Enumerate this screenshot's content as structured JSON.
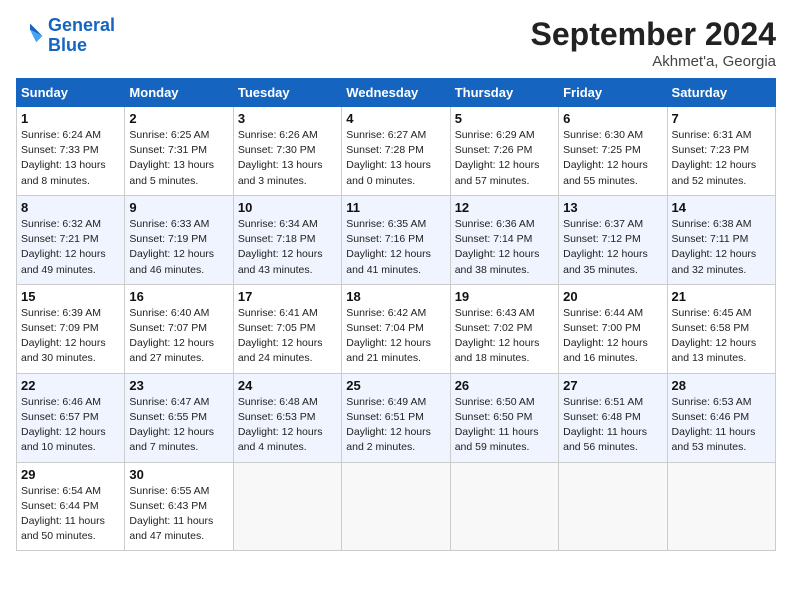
{
  "header": {
    "logo_line1": "General",
    "logo_line2": "Blue",
    "month_title": "September 2024",
    "subtitle": "Akhmet'a, Georgia"
  },
  "weekdays": [
    "Sunday",
    "Monday",
    "Tuesday",
    "Wednesday",
    "Thursday",
    "Friday",
    "Saturday"
  ],
  "weeks": [
    [
      {
        "day": "1",
        "sunrise": "6:24 AM",
        "sunset": "7:33 PM",
        "daylight": "13 hours and 8 minutes."
      },
      {
        "day": "2",
        "sunrise": "6:25 AM",
        "sunset": "7:31 PM",
        "daylight": "13 hours and 5 minutes."
      },
      {
        "day": "3",
        "sunrise": "6:26 AM",
        "sunset": "7:30 PM",
        "daylight": "13 hours and 3 minutes."
      },
      {
        "day": "4",
        "sunrise": "6:27 AM",
        "sunset": "7:28 PM",
        "daylight": "13 hours and 0 minutes."
      },
      {
        "day": "5",
        "sunrise": "6:29 AM",
        "sunset": "7:26 PM",
        "daylight": "12 hours and 57 minutes."
      },
      {
        "day": "6",
        "sunrise": "6:30 AM",
        "sunset": "7:25 PM",
        "daylight": "12 hours and 55 minutes."
      },
      {
        "day": "7",
        "sunrise": "6:31 AM",
        "sunset": "7:23 PM",
        "daylight": "12 hours and 52 minutes."
      }
    ],
    [
      {
        "day": "8",
        "sunrise": "6:32 AM",
        "sunset": "7:21 PM",
        "daylight": "12 hours and 49 minutes."
      },
      {
        "day": "9",
        "sunrise": "6:33 AM",
        "sunset": "7:19 PM",
        "daylight": "12 hours and 46 minutes."
      },
      {
        "day": "10",
        "sunrise": "6:34 AM",
        "sunset": "7:18 PM",
        "daylight": "12 hours and 43 minutes."
      },
      {
        "day": "11",
        "sunrise": "6:35 AM",
        "sunset": "7:16 PM",
        "daylight": "12 hours and 41 minutes."
      },
      {
        "day": "12",
        "sunrise": "6:36 AM",
        "sunset": "7:14 PM",
        "daylight": "12 hours and 38 minutes."
      },
      {
        "day": "13",
        "sunrise": "6:37 AM",
        "sunset": "7:12 PM",
        "daylight": "12 hours and 35 minutes."
      },
      {
        "day": "14",
        "sunrise": "6:38 AM",
        "sunset": "7:11 PM",
        "daylight": "12 hours and 32 minutes."
      }
    ],
    [
      {
        "day": "15",
        "sunrise": "6:39 AM",
        "sunset": "7:09 PM",
        "daylight": "12 hours and 30 minutes."
      },
      {
        "day": "16",
        "sunrise": "6:40 AM",
        "sunset": "7:07 PM",
        "daylight": "12 hours and 27 minutes."
      },
      {
        "day": "17",
        "sunrise": "6:41 AM",
        "sunset": "7:05 PM",
        "daylight": "12 hours and 24 minutes."
      },
      {
        "day": "18",
        "sunrise": "6:42 AM",
        "sunset": "7:04 PM",
        "daylight": "12 hours and 21 minutes."
      },
      {
        "day": "19",
        "sunrise": "6:43 AM",
        "sunset": "7:02 PM",
        "daylight": "12 hours and 18 minutes."
      },
      {
        "day": "20",
        "sunrise": "6:44 AM",
        "sunset": "7:00 PM",
        "daylight": "12 hours and 16 minutes."
      },
      {
        "day": "21",
        "sunrise": "6:45 AM",
        "sunset": "6:58 PM",
        "daylight": "12 hours and 13 minutes."
      }
    ],
    [
      {
        "day": "22",
        "sunrise": "6:46 AM",
        "sunset": "6:57 PM",
        "daylight": "12 hours and 10 minutes."
      },
      {
        "day": "23",
        "sunrise": "6:47 AM",
        "sunset": "6:55 PM",
        "daylight": "12 hours and 7 minutes."
      },
      {
        "day": "24",
        "sunrise": "6:48 AM",
        "sunset": "6:53 PM",
        "daylight": "12 hours and 4 minutes."
      },
      {
        "day": "25",
        "sunrise": "6:49 AM",
        "sunset": "6:51 PM",
        "daylight": "12 hours and 2 minutes."
      },
      {
        "day": "26",
        "sunrise": "6:50 AM",
        "sunset": "6:50 PM",
        "daylight": "11 hours and 59 minutes."
      },
      {
        "day": "27",
        "sunrise": "6:51 AM",
        "sunset": "6:48 PM",
        "daylight": "11 hours and 56 minutes."
      },
      {
        "day": "28",
        "sunrise": "6:53 AM",
        "sunset": "6:46 PM",
        "daylight": "11 hours and 53 minutes."
      }
    ],
    [
      {
        "day": "29",
        "sunrise": "6:54 AM",
        "sunset": "6:44 PM",
        "daylight": "11 hours and 50 minutes."
      },
      {
        "day": "30",
        "sunrise": "6:55 AM",
        "sunset": "6:43 PM",
        "daylight": "11 hours and 47 minutes."
      },
      null,
      null,
      null,
      null,
      null
    ]
  ]
}
